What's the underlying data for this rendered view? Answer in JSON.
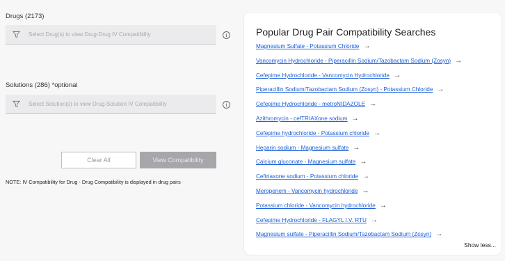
{
  "drugs": {
    "label": "Drugs (2173)",
    "placeholder": "Select Drug(s) to view Drug-Drug IV Compatibility"
  },
  "solutions": {
    "label": "Solutions (286) *optional",
    "placeholder": "Select Solution(s) to view Drug-Solution IV Compatibility"
  },
  "info_symbol": "i",
  "buttons": {
    "clear": "Clear All",
    "view": "View Compatibility"
  },
  "note": "NOTE: IV Compatibility for Drug - Drug Compatibility is displayed in drug pairs",
  "popular": {
    "title": "Popular Drug Pair Compatibility Searches",
    "arrow": "→",
    "items": [
      "Magnesium Sulfate - Potassium Chloride",
      "Vancomycin Hydrochloride - Piperacillin Sodium/Tazobactam Sodium (Zosyn)",
      "Cefepime Hydrochloride - Vancomycin Hydrochloride",
      "Piperacillin Sodium/Tazobactam Sodium (Zosyn) - Potassium Chloride",
      "Cefepime Hydrochloride - metroNIDAZOLE",
      "Azithromycin - cefTRIAXone sodium",
      "Cefepime hydrochloride - Potassium chloride",
      "Heparin sodium - Magnesium sulfate",
      "Calcium gluconate - Magnesium sulfate",
      "Ceftriaxone sodium - Potassium chloride",
      "Meropenem - Vancomycin hydrochloride",
      "Potassium chloride - Vancomycin hydrochloride",
      "Cefepime Hydrochloride - FLAGYL I.V. RTU",
      "Magnesium sulfate - Piperacillin Sodium/Tazobactam Sodium (Zosyn)"
    ],
    "show_less": "Show less..."
  },
  "colors": {
    "link": "#1b5fd8",
    "button_disabled": "#a7a7ab",
    "field_bg": "#ebebed"
  }
}
